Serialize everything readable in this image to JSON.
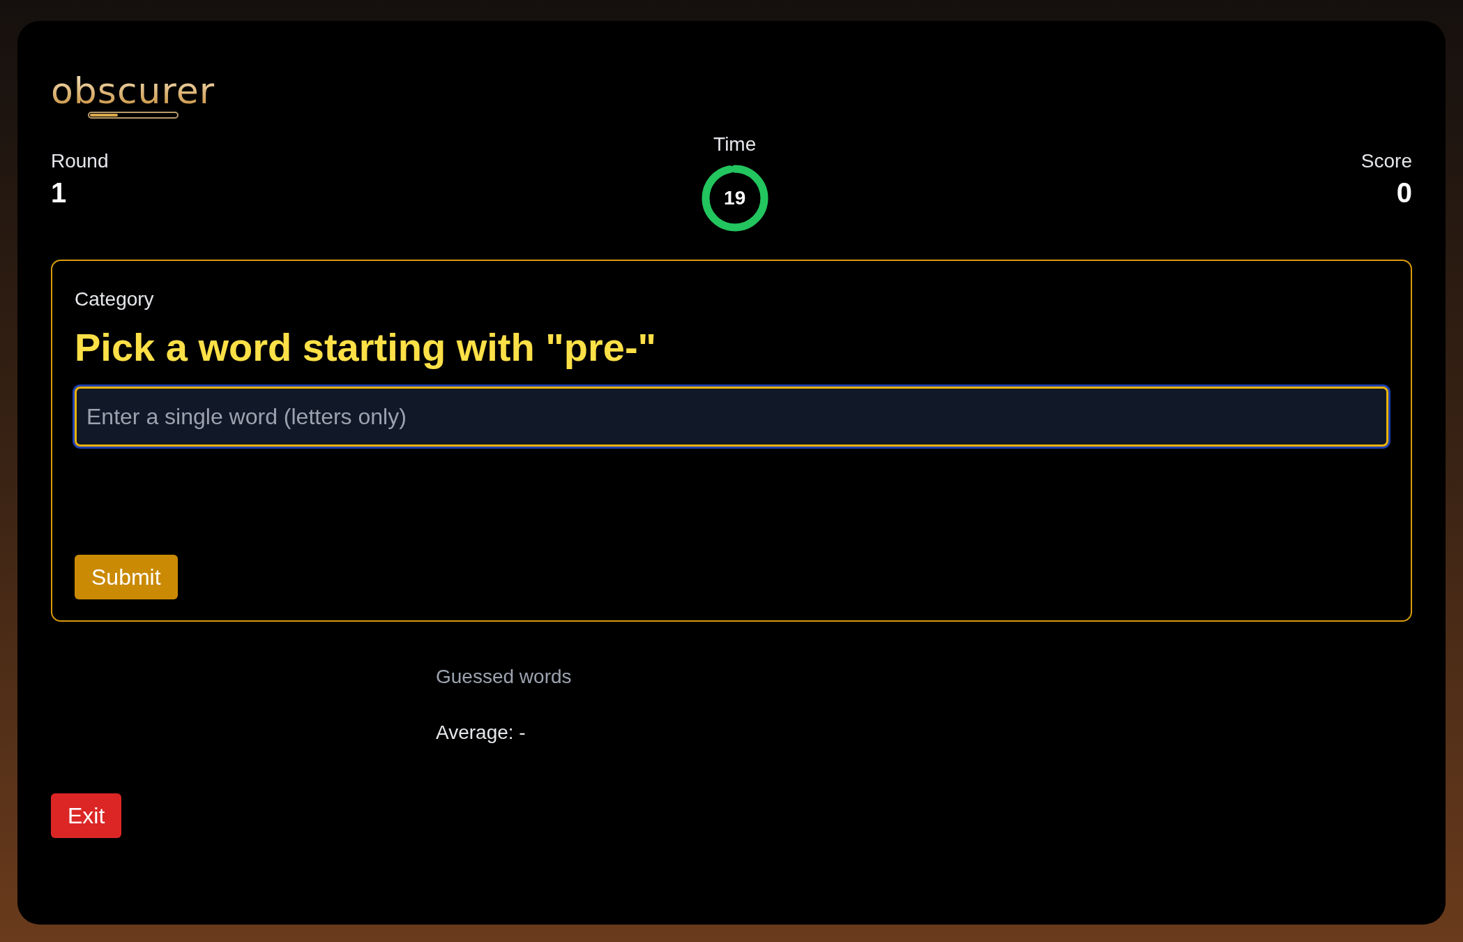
{
  "logo": {
    "text": "obscurer",
    "level": 0.33
  },
  "round": {
    "label": "Round",
    "value": "1"
  },
  "timer": {
    "label": "Time",
    "value": "19",
    "level": 0.97
  },
  "score": {
    "label": "Score",
    "value": "0"
  },
  "card": {
    "label": "Category",
    "title": "Pick a word starting with \"pre-\"",
    "input": {
      "placeholder": "Enter a single word (letters only)"
    },
    "submit": "Submit"
  },
  "guessed": {
    "label": "Guessed words",
    "average": "Average: -"
  },
  "exit": "Exit"
}
